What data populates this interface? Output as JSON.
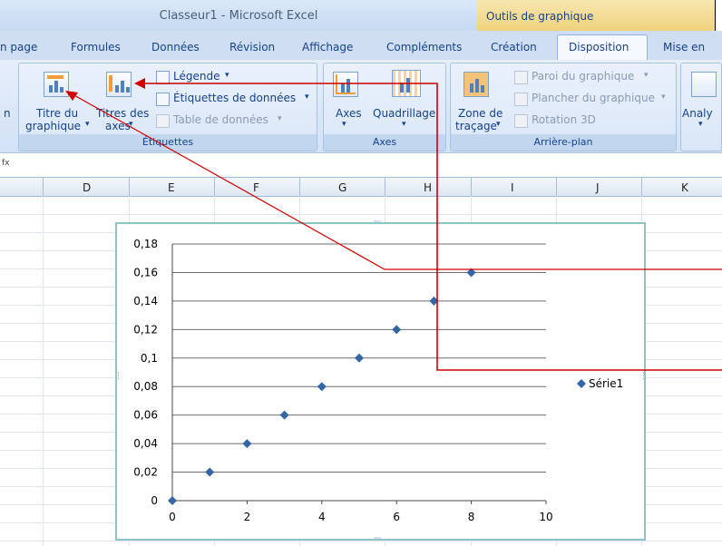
{
  "window": {
    "title": "Classeur1 - Microsoft Excel",
    "context_tab": "Outils de graphique"
  },
  "tabs": [
    {
      "label": "n page"
    },
    {
      "label": "Formules"
    },
    {
      "label": "Données"
    },
    {
      "label": "Révision"
    },
    {
      "label": "Affichage"
    },
    {
      "label": "Compléments"
    },
    {
      "label": "Création"
    },
    {
      "label": "Disposition"
    },
    {
      "label": "Mise en"
    }
  ],
  "ribbon": {
    "cut_left": "n",
    "titre_du": "Titre du",
    "graphique": "graphique",
    "titres_des": "Titres des",
    "axes_small": "axes",
    "legende": "Légende",
    "etiquettes_donnees": "Étiquettes de données",
    "table_donnees": "Table de données",
    "group_etiquettes": "Étiquettes",
    "axes": "Axes",
    "quadrillage": "Quadrillage",
    "group_axes": "Axes",
    "zone_de": "Zone de",
    "tracage": "traçage",
    "paroi": "Paroi du graphique",
    "plancher": "Plancher du graphique",
    "rotation": "Rotation 3D",
    "group_arriere": "Arrière-plan",
    "analy": "Analy",
    "dropdown": "▾"
  },
  "formula_bar": {
    "fx": "fx"
  },
  "columns": [
    "D",
    "E",
    "F",
    "G",
    "H",
    "I",
    "J",
    "K"
  ],
  "colors": {
    "series": "#3465a4",
    "arrow": "#d00000"
  },
  "chart_data": {
    "type": "scatter",
    "series": [
      {
        "name": "Série1",
        "x": [
          0,
          1,
          2,
          3,
          4,
          5,
          6,
          7,
          8
        ],
        "y": [
          0,
          0.02,
          0.04,
          0.06,
          0.08,
          0.1,
          0.12,
          0.14,
          0.16
        ]
      }
    ],
    "xlim": [
      0,
      10
    ],
    "ylim": [
      0,
      0.18
    ],
    "x_ticks": [
      "0",
      "2",
      "4",
      "6",
      "8",
      "10"
    ],
    "y_ticks": [
      "0",
      "0,02",
      "0,04",
      "0,06",
      "0,08",
      "0,1",
      "0,12",
      "0,14",
      "0,16",
      "0,18"
    ],
    "grid": true,
    "legend": "right"
  }
}
